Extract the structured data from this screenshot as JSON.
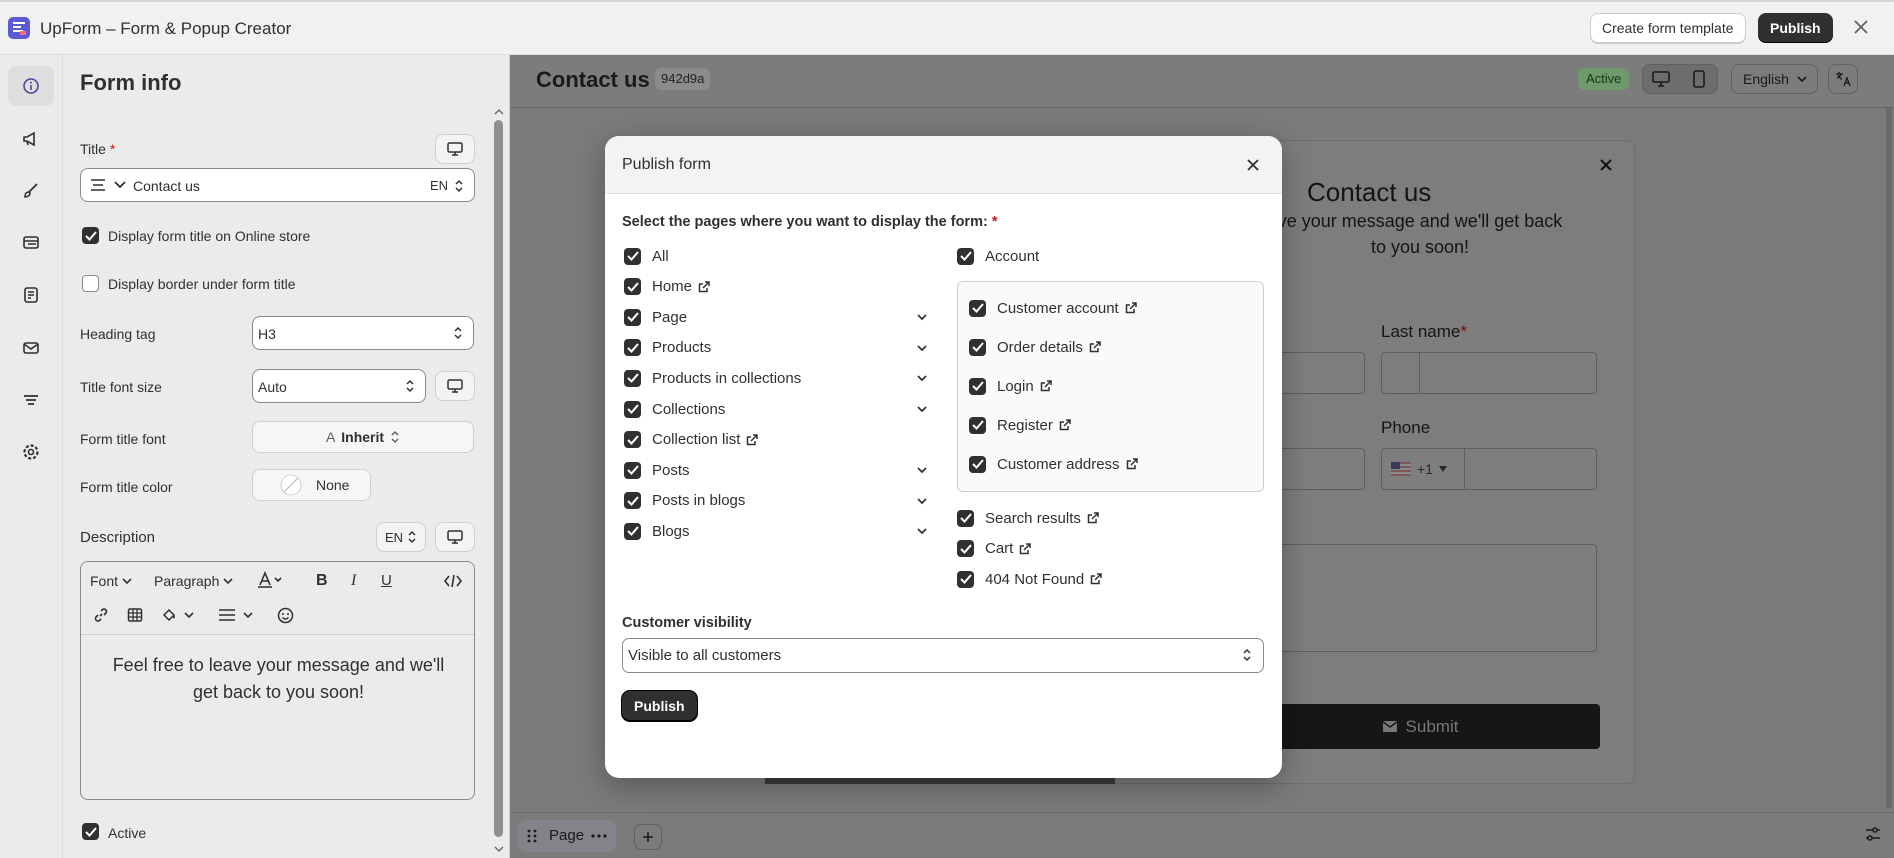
{
  "app": {
    "title": "UpForm – Form & Popup Creator",
    "create_template_label": "Create form template",
    "publish_label": "Publish"
  },
  "rail": {
    "items": [
      "info",
      "megaphone",
      "brush",
      "layout",
      "template",
      "mail",
      "lines",
      "settings"
    ]
  },
  "form_info": {
    "heading": "Form info",
    "title_label": "Title",
    "title_value": "Contact us",
    "title_lang": "EN",
    "display_title_label": "Display form title on Online store",
    "display_title_checked": true,
    "display_border_label": "Display border under form title",
    "display_border_checked": false,
    "heading_tag_label": "Heading tag",
    "heading_tag_value": "H3",
    "title_font_size_label": "Title font size",
    "title_font_size_value": "Auto",
    "form_title_font_label": "Form title font",
    "form_title_font_value": "Inherit",
    "form_title_color_label": "Form title color",
    "form_title_color_value": "None",
    "description_label": "Description",
    "description_lang": "EN",
    "toolbar_font": "Font",
    "toolbar_paragraph": "Paragraph",
    "description_text": "Feel free to leave your message and we'll get back to you soon!",
    "active_label": "Active",
    "active_checked": true
  },
  "preview": {
    "form_name": "Contact us",
    "form_hash": "942d9a",
    "status": "Active",
    "language": "English",
    "card_title": "Contact us",
    "card_subtitle": "ve your message and we'll get back to you soon!",
    "last_name_label": "Last name",
    "phone_label": "Phone",
    "phone_code": "+1",
    "submit_label": "Submit",
    "page_chip_label": "Page"
  },
  "modal": {
    "title": "Publish form",
    "pages_prompt": "Select the pages where you want to display the form:",
    "left_options": [
      {
        "label": "All",
        "checked": true,
        "external": false,
        "expandable": false
      },
      {
        "label": "Home",
        "checked": true,
        "external": true,
        "expandable": false
      },
      {
        "label": "Page",
        "checked": true,
        "external": false,
        "expandable": true
      },
      {
        "label": "Products",
        "checked": true,
        "external": false,
        "expandable": true
      },
      {
        "label": "Products in collections",
        "checked": true,
        "external": false,
        "expandable": true
      },
      {
        "label": "Collections",
        "checked": true,
        "external": false,
        "expandable": true
      },
      {
        "label": "Collection list",
        "checked": true,
        "external": true,
        "expandable": false
      },
      {
        "label": "Posts",
        "checked": true,
        "external": false,
        "expandable": true
      },
      {
        "label": "Posts in blogs",
        "checked": true,
        "external": false,
        "expandable": true
      },
      {
        "label": "Blogs",
        "checked": true,
        "external": false,
        "expandable": true
      }
    ],
    "account_label": "Account",
    "account_options": [
      {
        "label": "Customer account",
        "checked": true
      },
      {
        "label": "Order details",
        "checked": true
      },
      {
        "label": "Login",
        "checked": true
      },
      {
        "label": "Register",
        "checked": true
      },
      {
        "label": "Customer address",
        "checked": true
      }
    ],
    "right_options": [
      {
        "label": "Search results",
        "checked": true
      },
      {
        "label": "Cart",
        "checked": true
      },
      {
        "label": "404 Not Found",
        "checked": true
      }
    ],
    "visibility_label": "Customer visibility",
    "visibility_value": "Visible to all customers",
    "publish_label": "Publish"
  }
}
